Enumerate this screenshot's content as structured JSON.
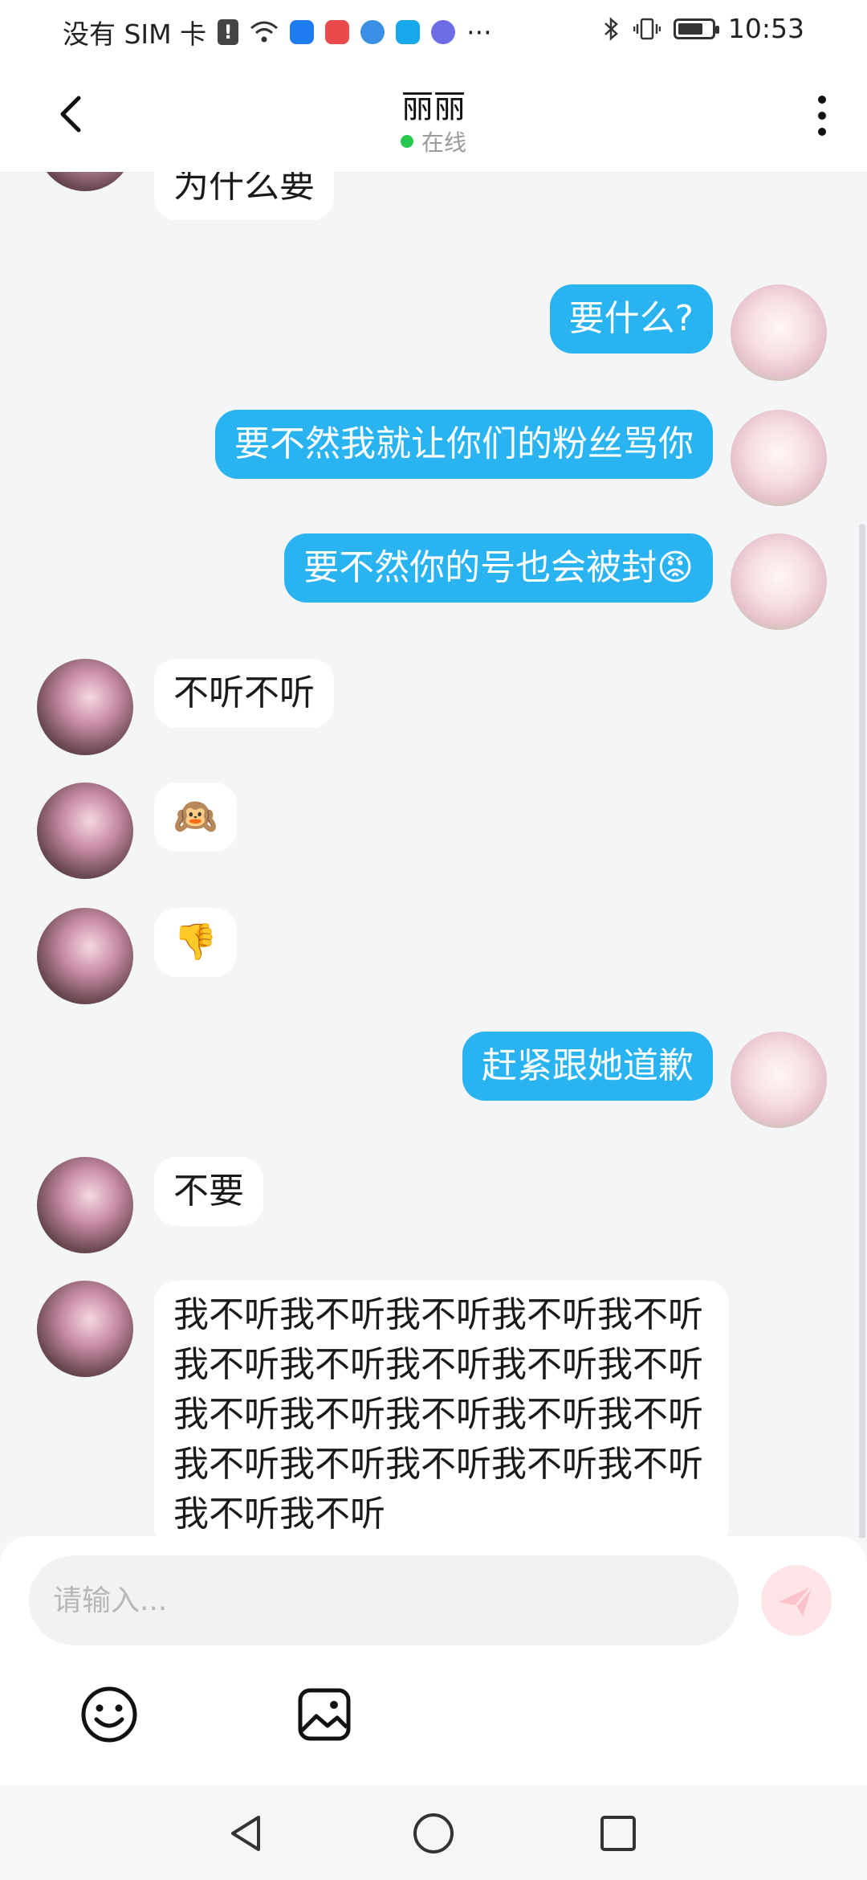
{
  "status_bar": {
    "carrier": "没有 SIM 卡",
    "more_dots": "···",
    "time": "10:53"
  },
  "header": {
    "title": "丽丽",
    "status": "在线"
  },
  "messages": [
    {
      "side": "left",
      "text": "为什么要"
    },
    {
      "side": "right",
      "text": "要什么?"
    },
    {
      "side": "right",
      "text": "要不然我就让你们的粉丝骂你"
    },
    {
      "side": "right",
      "text": "要不然你的号也会被封😡"
    },
    {
      "side": "left",
      "text": "不听不听"
    },
    {
      "side": "left",
      "text": "🙉"
    },
    {
      "side": "left",
      "text": "👎"
    },
    {
      "side": "right",
      "text": "赶紧跟她道歉"
    },
    {
      "side": "left",
      "text": "不要"
    },
    {
      "side": "left",
      "text": "我不听我不听我不听我不听我不听我不听我不听我不听我不听我不听我不听我不听我不听我不听我不听我不听我不听我不听我不听我不听我不听我不听"
    }
  ],
  "composer": {
    "placeholder": "请输入..."
  },
  "colors": {
    "outgoing_bubble": "#29b4f1",
    "incoming_bubble": "#ffffff",
    "online_dot": "#26c94f",
    "send_button": "#fde4e6"
  },
  "icons": {
    "back": "chevron-left-icon",
    "more": "more-vertical-icon",
    "emoji": "smiley-icon",
    "image": "image-icon",
    "send": "send-icon"
  }
}
